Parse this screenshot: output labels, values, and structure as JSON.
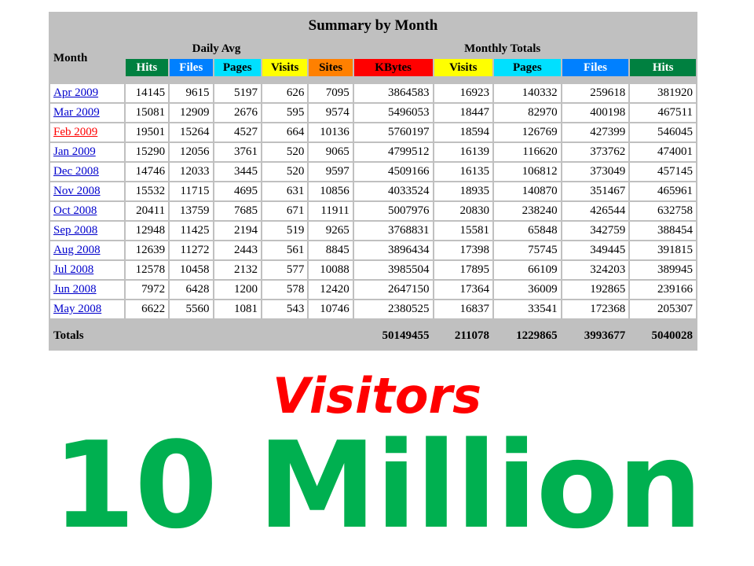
{
  "table": {
    "title": "Summary by Month",
    "month_header": "Month",
    "daily_avg_header": "Daily Avg",
    "monthly_totals_header": "Monthly Totals",
    "columns": [
      {
        "label": "Hits",
        "color": "#008040",
        "text_color": "#ffffff"
      },
      {
        "label": "Files",
        "color": "#0080ff",
        "text_color": "#ffffff"
      },
      {
        "label": "Pages",
        "color": "#00e0ff",
        "text_color": "#000000"
      },
      {
        "label": "Visits",
        "color": "#ffff00",
        "text_color": "#000000"
      },
      {
        "label": "Sites",
        "color": "#ff8000",
        "text_color": "#000000"
      },
      {
        "label": "KBytes",
        "color": "#ff0000",
        "text_color": "#000000"
      },
      {
        "label": "Visits",
        "color": "#ffff00",
        "text_color": "#000000"
      },
      {
        "label": "Pages",
        "color": "#00e0ff",
        "text_color": "#000000"
      },
      {
        "label": "Files",
        "color": "#0080ff",
        "text_color": "#ffffff"
      },
      {
        "label": "Hits",
        "color": "#008040",
        "text_color": "#ffffff"
      }
    ],
    "rows": [
      {
        "month": "Apr 2009",
        "current": false,
        "values": [
          "14145",
          "9615",
          "5197",
          "626",
          "7095",
          "3864583",
          "16923",
          "140332",
          "259618",
          "381920"
        ]
      },
      {
        "month": "Mar 2009",
        "current": false,
        "values": [
          "15081",
          "12909",
          "2676",
          "595",
          "9574",
          "5496053",
          "18447",
          "82970",
          "400198",
          "467511"
        ]
      },
      {
        "month": "Feb 2009",
        "current": true,
        "values": [
          "19501",
          "15264",
          "4527",
          "664",
          "10136",
          "5760197",
          "18594",
          "126769",
          "427399",
          "546045"
        ]
      },
      {
        "month": "Jan 2009",
        "current": false,
        "values": [
          "15290",
          "12056",
          "3761",
          "520",
          "9065",
          "4799512",
          "16139",
          "116620",
          "373762",
          "474001"
        ]
      },
      {
        "month": "Dec 2008",
        "current": false,
        "values": [
          "14746",
          "12033",
          "3445",
          "520",
          "9597",
          "4509166",
          "16135",
          "106812",
          "373049",
          "457145"
        ]
      },
      {
        "month": "Nov 2008",
        "current": false,
        "values": [
          "15532",
          "11715",
          "4695",
          "631",
          "10856",
          "4033524",
          "18935",
          "140870",
          "351467",
          "465961"
        ]
      },
      {
        "month": "Oct 2008",
        "current": false,
        "values": [
          "20411",
          "13759",
          "7685",
          "671",
          "11911",
          "5007976",
          "20830",
          "238240",
          "426544",
          "632758"
        ]
      },
      {
        "month": "Sep 2008",
        "current": false,
        "values": [
          "12948",
          "11425",
          "2194",
          "519",
          "9265",
          "3768831",
          "15581",
          "65848",
          "342759",
          "388454"
        ]
      },
      {
        "month": "Aug 2008",
        "current": false,
        "values": [
          "12639",
          "11272",
          "2443",
          "561",
          "8845",
          "3896434",
          "17398",
          "75745",
          "349445",
          "391815"
        ]
      },
      {
        "month": "Jul 2008",
        "current": false,
        "values": [
          "12578",
          "10458",
          "2132",
          "577",
          "10088",
          "3985504",
          "17895",
          "66109",
          "324203",
          "389945"
        ]
      },
      {
        "month": "Jun 2008",
        "current": false,
        "values": [
          "7972",
          "6428",
          "1200",
          "578",
          "12420",
          "2647150",
          "17364",
          "36009",
          "192865",
          "239166"
        ]
      },
      {
        "month": "May 2008",
        "current": false,
        "values": [
          "6622",
          "5560",
          "1081",
          "543",
          "10746",
          "2380525",
          "16837",
          "33541",
          "172368",
          "205307"
        ]
      }
    ],
    "totals": {
      "label": "Totals",
      "values": [
        "50149455",
        "211078",
        "1229865",
        "3993677",
        "5040028"
      ]
    }
  },
  "headline": {
    "visitors": "Visitors",
    "million": "10 Million",
    "visitors_color": "#ff0000",
    "million_color": "#00b050"
  }
}
